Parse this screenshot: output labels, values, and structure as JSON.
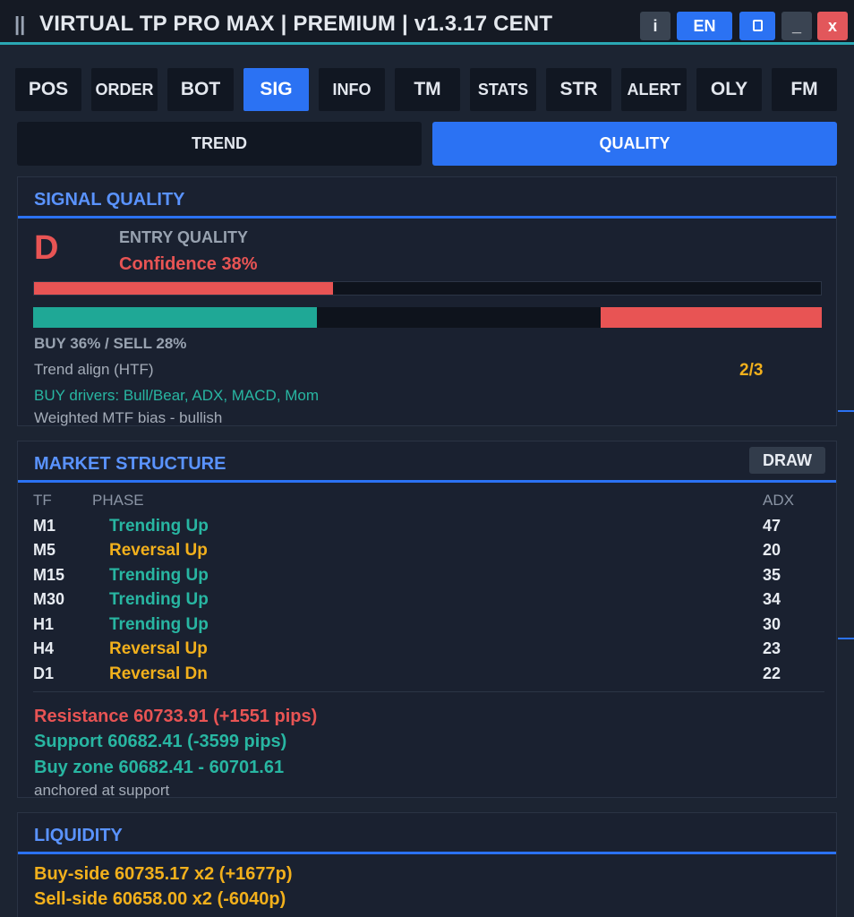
{
  "window": {
    "grip": "||",
    "title": "VIRTUAL TP PRO MAX | PREMIUM | v1.3.17  CENT",
    "buttons": {
      "info": "i",
      "lang": "EN",
      "minimize": "_",
      "close": "x"
    }
  },
  "tabs": [
    "POS",
    "ORDER",
    "BOT",
    "SIG",
    "INFO",
    "TM",
    "STATS",
    "STR",
    "ALERT",
    "OLY",
    "FM"
  ],
  "active_tab": "SIG",
  "subtabs": {
    "trend": "TREND",
    "quality": "QUALITY",
    "active": "QUALITY"
  },
  "signal_quality": {
    "title": "SIGNAL QUALITY",
    "grade": "D",
    "label": "ENTRY QUALITY",
    "confidence_text": "Confidence 38%",
    "confidence": 0.38,
    "buy_fraction": 0.36,
    "sell_fraction": 0.28,
    "buy_sell_text": "BUY 36%  /  SELL 28%",
    "trend_align_label": "Trend align (HTF)",
    "trend_align_value": "2/3",
    "drivers": "BUY drivers: Bull/Bear, ADX, MACD, Mom",
    "mtf_bias": "Weighted MTF bias  -  bullish"
  },
  "market_structure": {
    "title": "MARKET STRUCTURE",
    "draw_label": "DRAW",
    "headers": {
      "tf": "TF",
      "phase": "PHASE",
      "adx": "ADX"
    },
    "rows": [
      {
        "tf": "M1",
        "phase": "Trending Up",
        "adx": "47"
      },
      {
        "tf": "M5",
        "phase": "Reversal Up",
        "adx": "20"
      },
      {
        "tf": "M15",
        "phase": "Trending Up",
        "adx": "35"
      },
      {
        "tf": "M30",
        "phase": "Trending Up",
        "adx": "34"
      },
      {
        "tf": "H1",
        "phase": "Trending Up",
        "adx": "30"
      },
      {
        "tf": "H4",
        "phase": "Reversal Up",
        "adx": "23"
      },
      {
        "tf": "D1",
        "phase": "Reversal Dn",
        "adx": "22"
      }
    ],
    "resistance": "Resistance  60733.91  (+1551 pips)",
    "support": "Support  60682.41  (-3599 pips)",
    "buy_zone": "Buy zone  60682.41 - 60701.61",
    "anchored": "anchored at support"
  },
  "liquidity": {
    "title": "LIQUIDITY",
    "buy_side": "Buy-side  60735.17  x2  (+1677p)",
    "sell_side": "Sell-side 60658.00  x2  (-6040p)"
  },
  "colors": {
    "accent": "#2b72f3",
    "trend_up": "#28b6a2",
    "reversal": "#f2b01c",
    "bear": "#e85454",
    "teal_rule": "#2aa8b4"
  }
}
